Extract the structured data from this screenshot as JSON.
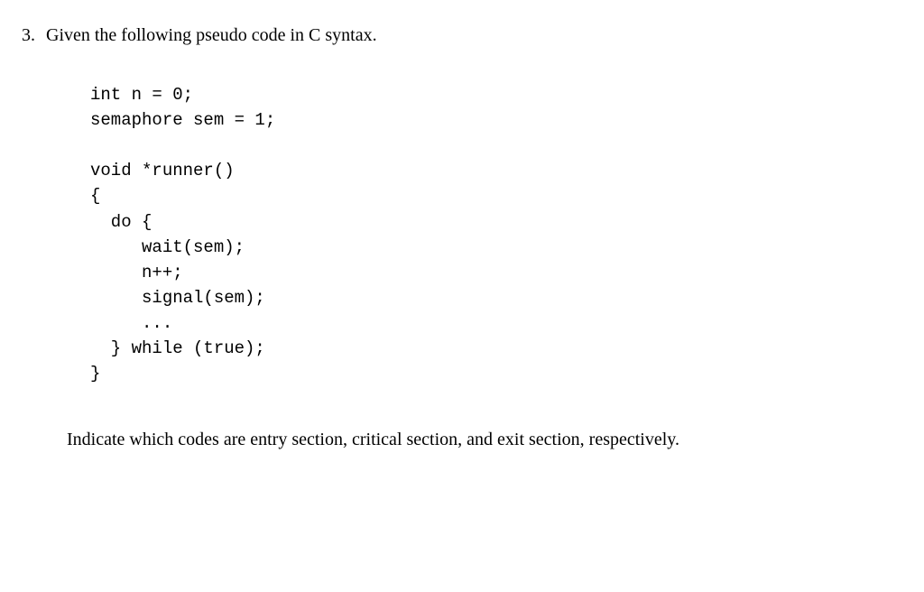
{
  "question": {
    "number": "3.",
    "text": "Given the following pseudo code in C syntax."
  },
  "code": {
    "line1": "int n = 0;",
    "line2": "semaphore sem = 1;",
    "line3": "",
    "line4": "void *runner()",
    "line5": "{",
    "line6": "  do {",
    "line7": "     wait(sem);",
    "line8": "     n++;",
    "line9": "     signal(sem);",
    "line10": "     ...",
    "line11": "  } while (true);",
    "line12": "}"
  },
  "instruction": "Indicate which codes are entry section, critical section, and exit section, respectively."
}
